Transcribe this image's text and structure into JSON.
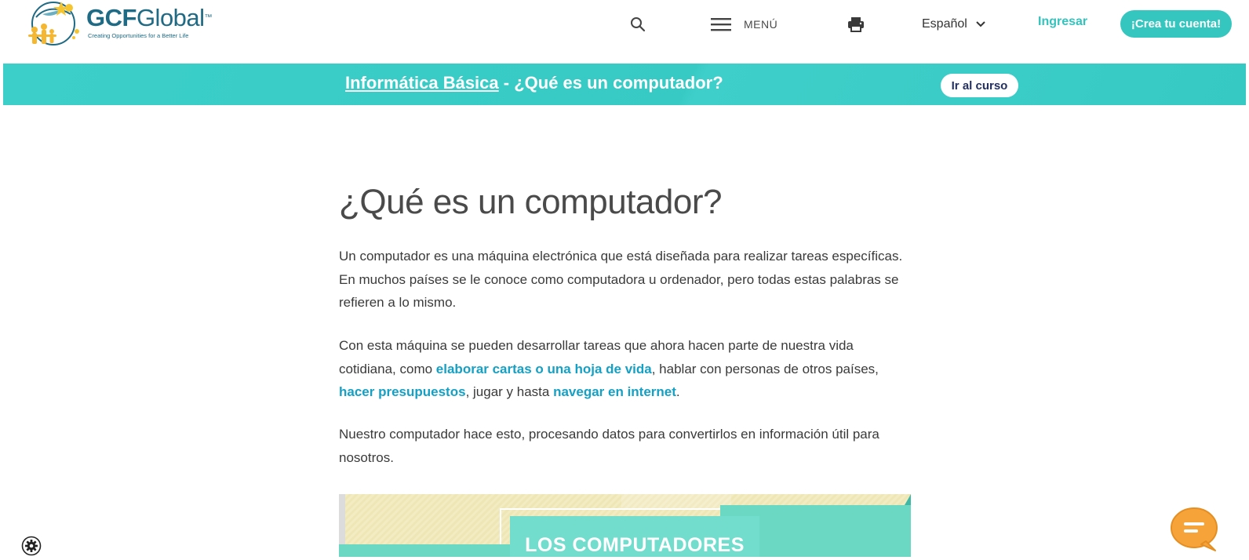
{
  "header": {
    "logo_text_bold": "GCF",
    "logo_text_rest": "Global",
    "logo_trademark": "™",
    "logo_tagline": "Creating Opportunities for a Better Life",
    "search_icon": "search-icon",
    "menu_label": "MENÚ",
    "menu_icon": "hamburger-icon",
    "print_icon": "printer-icon",
    "language_label": "Español",
    "language_icon": "chevron-down-icon",
    "login_label": "Ingresar",
    "signup_label": "¡Crea tu cuenta!",
    "accent_color": "#35c6bf",
    "brand_color": "#1f6a84"
  },
  "banner": {
    "course_link": "Informática Básica",
    "separator": " - ",
    "lesson_title": "¿Qué es un computador?",
    "go_to_course_label": "Ir al curso",
    "background_color": "#3ccfc9"
  },
  "article": {
    "title": "¿Qué es un computador?",
    "p1": "Un computador es una máquina electrónica que está diseñada para realizar tareas específicas. En muchos países se le conoce como computadora u ordenador, pero todas estas palabras se refieren a lo mismo.",
    "p2": {
      "t1": "Con esta máquina se pueden desarrollar tareas que ahora hacen parte de nuestra vida cotidiana, como ",
      "link1": "elaborar cartas o una hoja de vida",
      "t2": ", hablar con personas de otros países, ",
      "link2": "hacer presupuestos",
      "t3": ", jugar y hasta ",
      "link3": "navegar en internet",
      "t4": "."
    },
    "p3": "Nuestro computador hace esto, procesando datos para convertirlos en información útil para nosotros.",
    "link_color": "#15a0c4"
  },
  "infographic": {
    "title": "LOS COMPUTADORES"
  },
  "floating": {
    "settings_icon": "gear-icon",
    "chat_icon": "chat-bubble-icon",
    "chat_color": "#f6a33a"
  }
}
